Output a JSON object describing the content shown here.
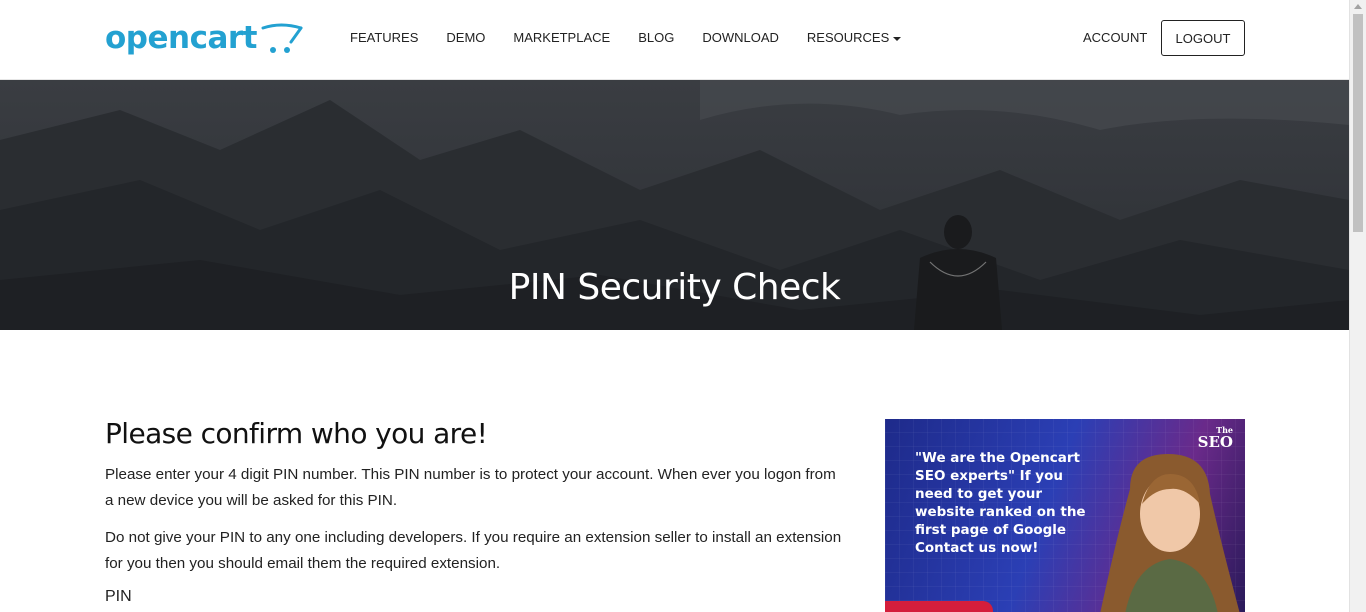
{
  "header": {
    "logo_text": "opencart",
    "nav": [
      {
        "label": "FEATURES"
      },
      {
        "label": "DEMO"
      },
      {
        "label": "MARKETPLACE"
      },
      {
        "label": "BLOG"
      },
      {
        "label": "DOWNLOAD"
      },
      {
        "label": "RESOURCES",
        "has_dropdown": true
      }
    ],
    "account_label": "ACCOUNT",
    "logout_label": "LOGOUT"
  },
  "hero": {
    "title": "PIN Security Check"
  },
  "main": {
    "heading": "Please confirm who you are!",
    "paragraph_1": "Please enter your 4 digit PIN number. This PIN number is to protect your account. When ever you logon from a new device you will be asked for this PIN.",
    "paragraph_2": "Do not give your PIN to any one including developers. If you require an extension seller to install an extension for you then you should email them the required extension.",
    "pin_label": "PIN"
  },
  "ad": {
    "text": "\"We are the Opencart SEO experts\" If you need to get your website ranked on the first page of Google Contact us now!",
    "brand_small": "The",
    "brand_big": "SEO"
  },
  "colors": {
    "brand": "#23a1d1",
    "hero_overlay": "#2d3035",
    "ad_accent": "#d41e3c"
  }
}
